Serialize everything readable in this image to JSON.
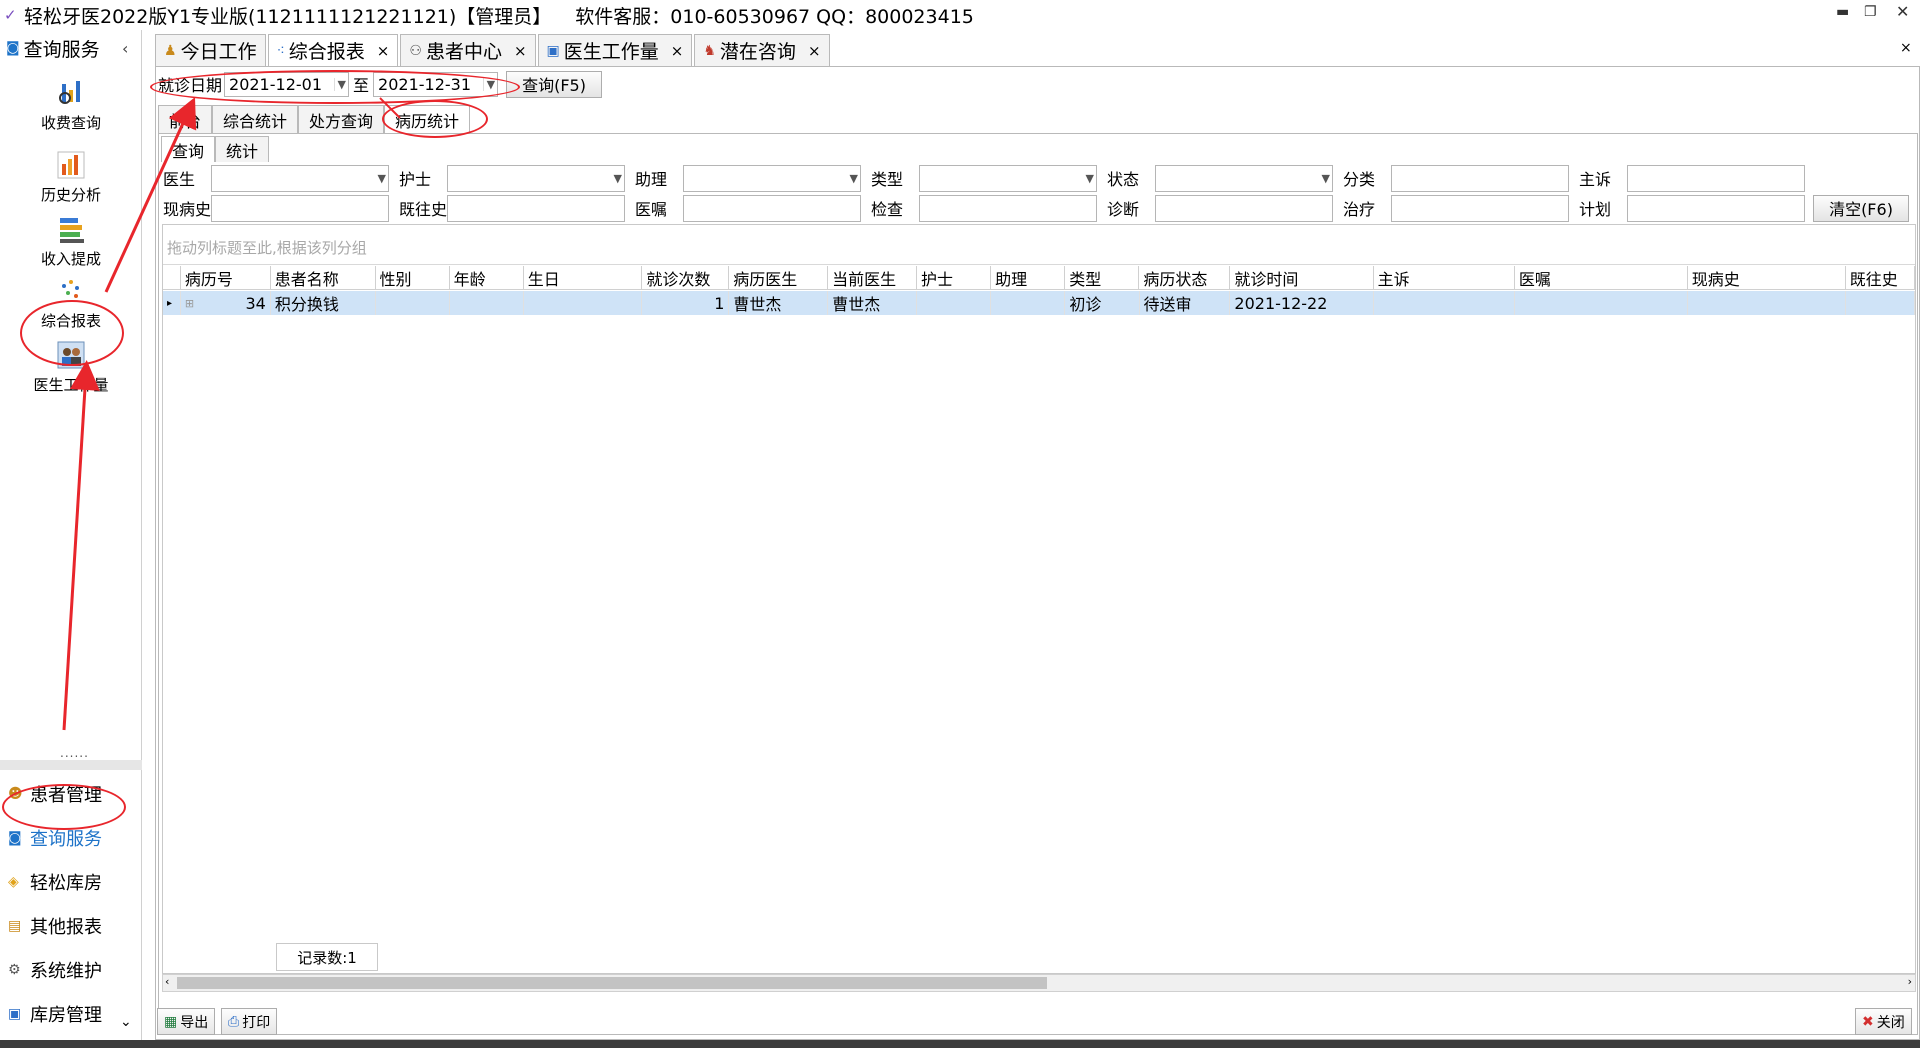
{
  "window": {
    "title": "轻松牙医2022版Y1专业版(1121111121221121)【管理员】",
    "service": "软件客服：010-60530967 QQ：800023415"
  },
  "sidebar": {
    "header": "查询服务",
    "items": [
      {
        "label": "收费查询",
        "icon": "receipt-search-icon"
      },
      {
        "label": "历史分析",
        "icon": "bar-chart-icon"
      },
      {
        "label": "收入提成",
        "icon": "stacked-books-icon"
      },
      {
        "label": "综合报表",
        "icon": "scatter-report-icon"
      },
      {
        "label": "医生工作量",
        "icon": "doctor-workload-icon"
      }
    ],
    "sep_dots": "......",
    "nav": [
      {
        "label": "患者管理",
        "icon": "patients-icon"
      },
      {
        "label": "查询服务",
        "icon": "search-service-icon"
      },
      {
        "label": "轻松库房",
        "icon": "warehouse-icon"
      },
      {
        "label": "其他报表",
        "icon": "report-icon"
      },
      {
        "label": "系统维护",
        "icon": "maintenance-icon"
      },
      {
        "label": "库房管理",
        "icon": "inventory-icon"
      }
    ]
  },
  "doc_tabs": [
    {
      "label": "今日工作",
      "closable": false
    },
    {
      "label": "综合报表",
      "closable": true
    },
    {
      "label": "患者中心",
      "closable": true
    },
    {
      "label": "医生工作量",
      "closable": true
    },
    {
      "label": "潜在咨询",
      "closable": true
    }
  ],
  "filter": {
    "date_label": "就诊日期",
    "date_from": "2021-12-01",
    "to_label": "至",
    "date_to": "2021-12-31",
    "query_button": "查询(F5)"
  },
  "sub_tabs": [
    "前台",
    "综合统计",
    "处方查询",
    "病历统计"
  ],
  "inner_tabs": [
    "查询",
    "统计"
  ],
  "form": {
    "row1": [
      "医生",
      "护士",
      "助理",
      "类型",
      "状态",
      "分类",
      "主诉"
    ],
    "row2": [
      "现病史",
      "既往史",
      "医嘱",
      "检查",
      "诊断",
      "治疗",
      "计划"
    ],
    "clear_button": "清空(F6)"
  },
  "grid": {
    "group_hint": "拖动列标题至此,根据该列分组",
    "columns": [
      "病历号",
      "患者名称",
      "性别",
      "年龄",
      "生日",
      "就诊次数",
      "病历医生",
      "当前医生",
      "护士",
      "助理",
      "类型",
      "病历状态",
      "就诊时间",
      "主诉",
      "医嘱",
      "现病史",
      "既往史"
    ],
    "rows": [
      [
        "34",
        "积分换钱",
        "",
        "",
        "",
        "1",
        "曹世杰",
        "曹世杰",
        "",
        "",
        "初诊",
        "待送审",
        "2021-12-22",
        "",
        "",
        "",
        ""
      ]
    ],
    "record_count": "记录数:1"
  },
  "bottom": {
    "export": "导出",
    "print": "打印",
    "close": "关闭"
  },
  "colors": {
    "annotation": "#e8262c",
    "row_selected": "#cfe3f7",
    "nav_active": "#1e73c8"
  }
}
